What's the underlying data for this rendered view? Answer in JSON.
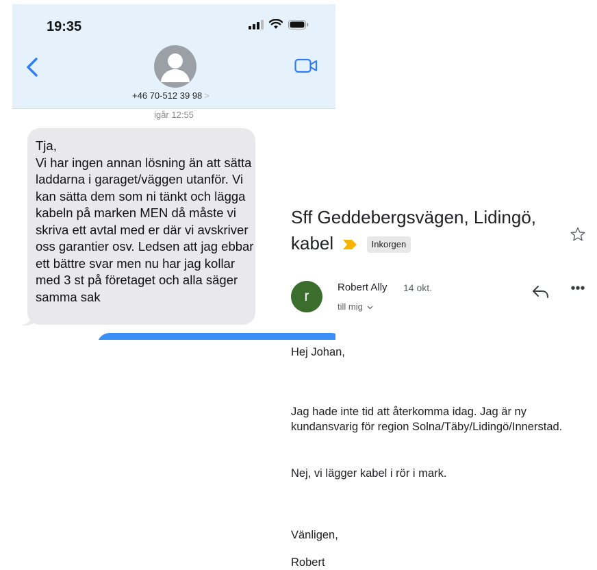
{
  "sms": {
    "status_time": "19:35",
    "contact_number": "+46 70-512 39 98",
    "contact_chevron": ">",
    "message_timestamp": "igår 12:55",
    "message_text": "Tja,\nVi har ingen annan lösning än att sätta laddarna i garaget/väggen utanför. Vi kan sätta dem som ni tänkt och lägga kabeln på marken MEN då måste vi skriva ett avtal med er där vi avskriver oss garantier osv. Ledsen att jag ebbar ett bättre svar men nu har jag kollar med 3 st på företaget och alla säger samma sak",
    "icons": [
      "signal-icon",
      "wifi-icon",
      "battery-icon",
      "back-chevron-icon",
      "contact-avatar-icon",
      "video-call-icon"
    ],
    "colors": {
      "header_bg": "#e6f2fb",
      "incoming_bubble": "#e9e9eb",
      "outgoing_bubble": "#3a8ff7",
      "accent": "#2f7cf6"
    }
  },
  "email": {
    "subject": "Sff  Geddebergsvägen, Lidingö, kabel",
    "label": "Inkorgen",
    "sender_initial": "r",
    "sender_name": "Robert Ally",
    "date": "14 okt.",
    "recipient": "till mig",
    "more_symbol": "•••",
    "body": {
      "greeting": "Hej Johan,",
      "paragraph1": "Jag hade inte tid att återkomma idag. Jag är ny kundansvarig för region Solna/Täby/Lidingö/Innerstad.",
      "paragraph2": "Nej, vi lägger kabel i rör i mark.",
      "closing": "Vänligen,",
      "signature": "Robert"
    },
    "icons": [
      "importance-marker-icon",
      "star-icon",
      "reply-icon",
      "more-options-icon",
      "chevron-down-icon"
    ],
    "colors": {
      "avatar_bg": "#3b6d2c",
      "importance": "#f4b400",
      "label_chip": "#e8e8e8"
    }
  }
}
